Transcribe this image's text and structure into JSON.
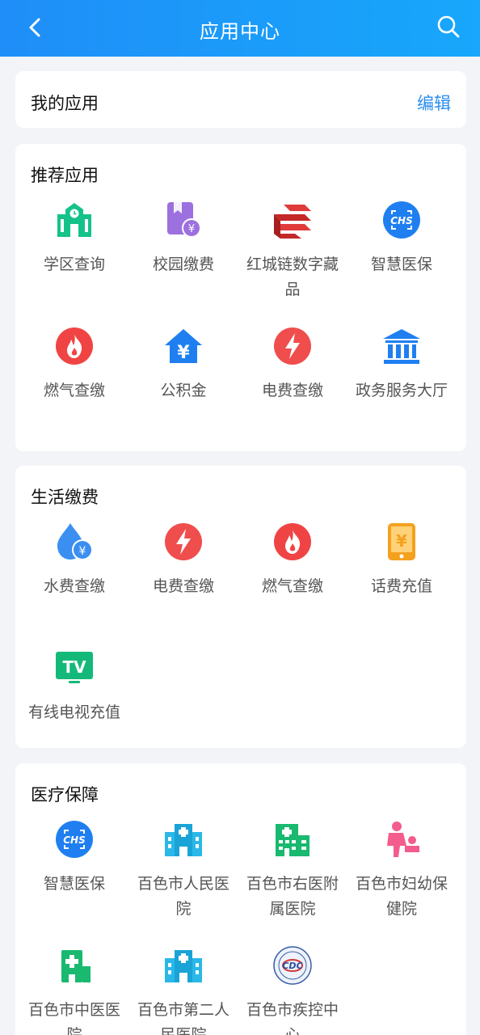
{
  "header": {
    "title": "应用中心"
  },
  "my_apps": {
    "title": "我的应用",
    "edit_label": "编辑"
  },
  "sections": {
    "recommended": {
      "title": "推荐应用",
      "apps": [
        {
          "label": "学区查询",
          "icon": "school-icon"
        },
        {
          "label": "校园缴费",
          "icon": "campus-payment-icon"
        },
        {
          "label": "红城链数字藏品",
          "icon": "digital-collectible-icon"
        },
        {
          "label": "智慧医保",
          "icon": "chs-icon"
        },
        {
          "label": "燃气查缴",
          "icon": "flame-icon"
        },
        {
          "label": "公积金",
          "icon": "housing-fund-icon"
        },
        {
          "label": "电费查缴",
          "icon": "lightning-icon"
        },
        {
          "label": "政务服务大厅",
          "icon": "government-hall-icon"
        }
      ]
    },
    "life": {
      "title": "生活缴费",
      "apps": [
        {
          "label": "水费查缴",
          "icon": "water-drop-icon"
        },
        {
          "label": "电费查缴",
          "icon": "lightning-icon"
        },
        {
          "label": "燃气查缴",
          "icon": "flame-icon"
        },
        {
          "label": "话费充值",
          "icon": "phone-recharge-icon"
        },
        {
          "label": "有线电视充值",
          "icon": "tv-icon"
        }
      ]
    },
    "medical": {
      "title": "医疗保障",
      "apps": [
        {
          "label": "智慧医保",
          "icon": "chs-icon"
        },
        {
          "label": "百色市人民医院",
          "icon": "hospital-icon"
        },
        {
          "label": "百色市右医附属医院",
          "icon": "hospital-building-icon"
        },
        {
          "label": "百色市妇幼保健院",
          "icon": "maternal-child-icon"
        },
        {
          "label": "百色市中医医院",
          "icon": "hospital-icon"
        },
        {
          "label": "百色市第二人民医院",
          "icon": "hospital-icon"
        },
        {
          "label": "百色市疾控中心",
          "icon": "cdc-seal-icon"
        }
      ]
    }
  }
}
